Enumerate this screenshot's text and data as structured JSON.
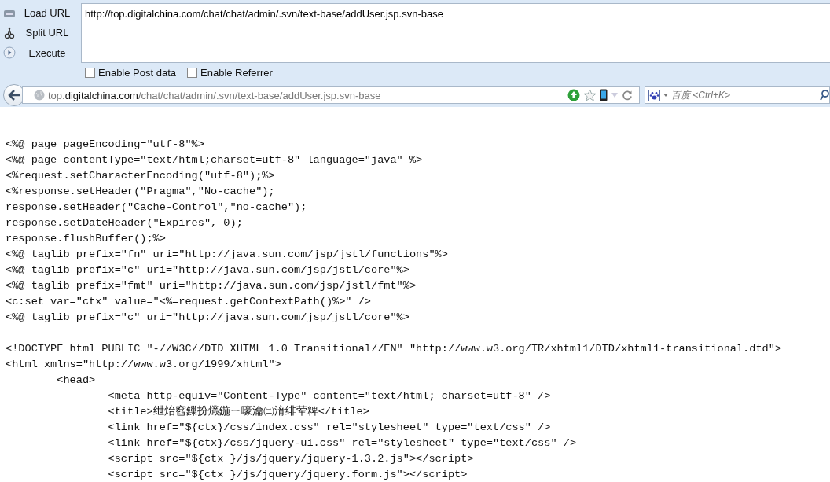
{
  "hackbar": {
    "actions": [
      {
        "kind": "load",
        "label": "Load URL"
      },
      {
        "kind": "split",
        "label": "Split URL"
      },
      {
        "kind": "execute",
        "label": "Execute"
      }
    ],
    "url_value": "http://top.digitalchina.com/chat/chat/admin/.svn/text-base/addUser.jsp.svn-base",
    "options": [
      {
        "label": "Enable Post data",
        "checked": false
      },
      {
        "label": "Enable Referrer",
        "checked": false
      }
    ]
  },
  "navbar": {
    "location": {
      "prefix": "top.",
      "domain": "digitalchina.com",
      "path": "/chat/chat/admin/.svn/text-base/addUser.jsp.svn-base"
    },
    "search": {
      "placeholder": "百度 <Ctrl+K>"
    }
  },
  "source_blocks": [
    [
      "<%@ page pageEncoding=\"utf-8\"%>",
      "<%@ page contentType=\"text/html;charset=utf-8\" language=\"java\" %>",
      "<%request.setCharacterEncoding(\"utf-8\");%>",
      "<%response.setHeader(\"Pragma\",\"No-cache\");",
      "response.setHeader(\"Cache-Control\",\"no-cache\");",
      "response.setDateHeader(\"Expires\", 0);",
      "response.flushBuffer();%>",
      "<%@ taglib prefix=\"fn\" uri=\"http://java.sun.com/jsp/jstl/functions\"%>",
      "<%@ taglib prefix=\"c\" uri=\"http://java.sun.com/jsp/jstl/core\"%>",
      "<%@ taglib prefix=\"fmt\" uri=\"http://java.sun.com/jsp/jstl/fmt\"%>",
      "<c:set var=\"ctx\" value=\"<%=request.getContextPath()%>\" />",
      "<%@ taglib prefix=\"c\" uri=\"http://java.sun.com/jsp/jstl/core\"%>"
    ],
    [
      "<!DOCTYPE html PUBLIC \"-//W3C//DTD XHTML 1.0 Transitional//EN\" \"http://www.w3.org/TR/xhtml1/DTD/xhtml1-transitional.dtd\">",
      "<html xmlns=\"http://www.w3.org/1999/xhtml\">",
      "\t<head>",
      "\t\t<meta http-equiv=\"Content-Type\" content=\"text/html; charset=utf-8\" />",
      "\t\t<title>绁炲窞鏁扮爜鍦ㄧ嚎瀹㈡湇绯荤粺</title>",
      "\t\t<link href=\"${ctx}/css/index.css\" rel=\"stylesheet\" type=\"text/css\" />",
      "\t\t<link href=\"${ctx}/css/jquery-ui.css\" rel=\"stylesheet\" type=\"text/css\" />",
      "\t\t<script src=\"${ctx }/js/jquery/jquery-1.3.2.js\"></script>",
      "\t\t<script src=\"${ctx }/js/jquery/jquery.form.js\"></script>"
    ]
  ]
}
